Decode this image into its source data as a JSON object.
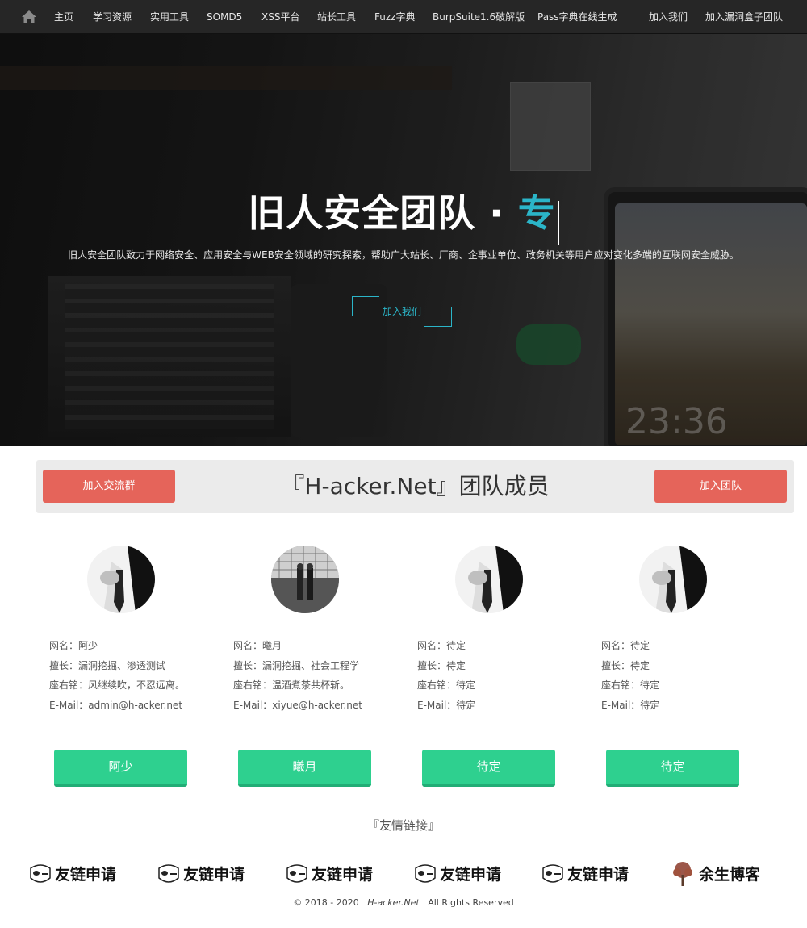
{
  "nav": {
    "home_icon": "home-icon",
    "items": [
      "主页",
      "学习资源",
      "实用工具",
      "SOMD5",
      "XSS平台",
      "站长工具",
      "Fuzz字典",
      "BurpSuite1.6破解版",
      "Pass字典在线生成"
    ],
    "right_items": [
      "加入我们",
      "加入漏洞盒子团队"
    ]
  },
  "hero": {
    "title_main": "旧人安全团队 · ",
    "title_accent": "专",
    "description": "旧人安全团队致力于网络安全、应用安全与WEB安全领域的研究探索，帮助广大站长、厂商、企事业单位、政务机关等用户应对变化多端的互联网安全威胁。",
    "button_label": "加入我们",
    "clock_text": "23:36",
    "accent_color": "#2bb5c8"
  },
  "team": {
    "left_button": "加入交流群",
    "title": "『H-acker.Net』团队成员",
    "right_button": "加入团队",
    "members": [
      {
        "name_line": "网名：阿少",
        "skill_line": "擅长：漏洞挖掘、渗透测试",
        "motto_line": "座右铭：风继续吹，不忍远离。",
        "email_line": "E-Mail：admin@h-acker.net",
        "button": "阿少"
      },
      {
        "name_line": "网名：曦月",
        "skill_line": "擅长：漏洞挖掘、社会工程学",
        "motto_line": "座右铭：温酒煮茶共杯斩。",
        "email_line": "E-Mail：xiyue@h-acker.net",
        "button": "曦月"
      },
      {
        "name_line": "网名：待定",
        "skill_line": "擅长：待定",
        "motto_line": "座右铭：待定",
        "email_line": "E-Mail：待定",
        "button": "待定"
      },
      {
        "name_line": "网名：待定",
        "skill_line": "擅长：待定",
        "motto_line": "座右铭：待定",
        "email_line": "E-Mail：待定",
        "button": "待定"
      }
    ]
  },
  "links": {
    "title": "『友情链接』",
    "items": [
      "友链申请",
      "友链申请",
      "友链申请",
      "友链申请",
      "友链申请",
      "余生博客"
    ]
  },
  "footer": {
    "prefix": "© 2018 - 2020",
    "brand": "H-acker.Net",
    "suffix": "All Rights Reserved"
  },
  "colors": {
    "nav_bg": "#262626",
    "red_button": "#e5645a",
    "green_button": "#2ed08f",
    "accent": "#2bb5c8"
  }
}
